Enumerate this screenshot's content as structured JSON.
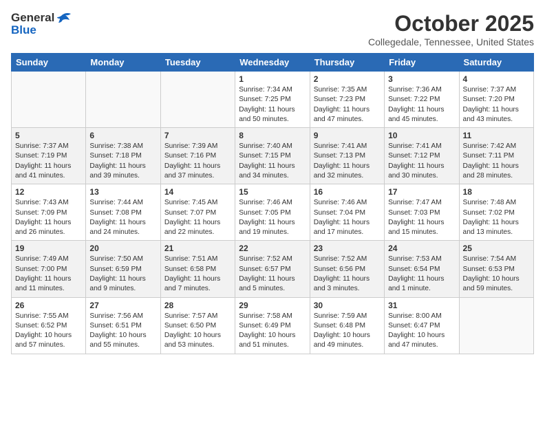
{
  "header": {
    "logo_general": "General",
    "logo_blue": "Blue",
    "month_title": "October 2025",
    "location": "Collegedale, Tennessee, United States"
  },
  "weekdays": [
    "Sunday",
    "Monday",
    "Tuesday",
    "Wednesday",
    "Thursday",
    "Friday",
    "Saturday"
  ],
  "weeks": [
    [
      {
        "num": "",
        "info": ""
      },
      {
        "num": "",
        "info": ""
      },
      {
        "num": "",
        "info": ""
      },
      {
        "num": "1",
        "info": "Sunrise: 7:34 AM\nSunset: 7:25 PM\nDaylight: 11 hours\nand 50 minutes."
      },
      {
        "num": "2",
        "info": "Sunrise: 7:35 AM\nSunset: 7:23 PM\nDaylight: 11 hours\nand 47 minutes."
      },
      {
        "num": "3",
        "info": "Sunrise: 7:36 AM\nSunset: 7:22 PM\nDaylight: 11 hours\nand 45 minutes."
      },
      {
        "num": "4",
        "info": "Sunrise: 7:37 AM\nSunset: 7:20 PM\nDaylight: 11 hours\nand 43 minutes."
      }
    ],
    [
      {
        "num": "5",
        "info": "Sunrise: 7:37 AM\nSunset: 7:19 PM\nDaylight: 11 hours\nand 41 minutes."
      },
      {
        "num": "6",
        "info": "Sunrise: 7:38 AM\nSunset: 7:18 PM\nDaylight: 11 hours\nand 39 minutes."
      },
      {
        "num": "7",
        "info": "Sunrise: 7:39 AM\nSunset: 7:16 PM\nDaylight: 11 hours\nand 37 minutes."
      },
      {
        "num": "8",
        "info": "Sunrise: 7:40 AM\nSunset: 7:15 PM\nDaylight: 11 hours\nand 34 minutes."
      },
      {
        "num": "9",
        "info": "Sunrise: 7:41 AM\nSunset: 7:13 PM\nDaylight: 11 hours\nand 32 minutes."
      },
      {
        "num": "10",
        "info": "Sunrise: 7:41 AM\nSunset: 7:12 PM\nDaylight: 11 hours\nand 30 minutes."
      },
      {
        "num": "11",
        "info": "Sunrise: 7:42 AM\nSunset: 7:11 PM\nDaylight: 11 hours\nand 28 minutes."
      }
    ],
    [
      {
        "num": "12",
        "info": "Sunrise: 7:43 AM\nSunset: 7:09 PM\nDaylight: 11 hours\nand 26 minutes."
      },
      {
        "num": "13",
        "info": "Sunrise: 7:44 AM\nSunset: 7:08 PM\nDaylight: 11 hours\nand 24 minutes."
      },
      {
        "num": "14",
        "info": "Sunrise: 7:45 AM\nSunset: 7:07 PM\nDaylight: 11 hours\nand 22 minutes."
      },
      {
        "num": "15",
        "info": "Sunrise: 7:46 AM\nSunset: 7:05 PM\nDaylight: 11 hours\nand 19 minutes."
      },
      {
        "num": "16",
        "info": "Sunrise: 7:46 AM\nSunset: 7:04 PM\nDaylight: 11 hours\nand 17 minutes."
      },
      {
        "num": "17",
        "info": "Sunrise: 7:47 AM\nSunset: 7:03 PM\nDaylight: 11 hours\nand 15 minutes."
      },
      {
        "num": "18",
        "info": "Sunrise: 7:48 AM\nSunset: 7:02 PM\nDaylight: 11 hours\nand 13 minutes."
      }
    ],
    [
      {
        "num": "19",
        "info": "Sunrise: 7:49 AM\nSunset: 7:00 PM\nDaylight: 11 hours\nand 11 minutes."
      },
      {
        "num": "20",
        "info": "Sunrise: 7:50 AM\nSunset: 6:59 PM\nDaylight: 11 hours\nand 9 minutes."
      },
      {
        "num": "21",
        "info": "Sunrise: 7:51 AM\nSunset: 6:58 PM\nDaylight: 11 hours\nand 7 minutes."
      },
      {
        "num": "22",
        "info": "Sunrise: 7:52 AM\nSunset: 6:57 PM\nDaylight: 11 hours\nand 5 minutes."
      },
      {
        "num": "23",
        "info": "Sunrise: 7:52 AM\nSunset: 6:56 PM\nDaylight: 11 hours\nand 3 minutes."
      },
      {
        "num": "24",
        "info": "Sunrise: 7:53 AM\nSunset: 6:54 PM\nDaylight: 11 hours\nand 1 minute."
      },
      {
        "num": "25",
        "info": "Sunrise: 7:54 AM\nSunset: 6:53 PM\nDaylight: 10 hours\nand 59 minutes."
      }
    ],
    [
      {
        "num": "26",
        "info": "Sunrise: 7:55 AM\nSunset: 6:52 PM\nDaylight: 10 hours\nand 57 minutes."
      },
      {
        "num": "27",
        "info": "Sunrise: 7:56 AM\nSunset: 6:51 PM\nDaylight: 10 hours\nand 55 minutes."
      },
      {
        "num": "28",
        "info": "Sunrise: 7:57 AM\nSunset: 6:50 PM\nDaylight: 10 hours\nand 53 minutes."
      },
      {
        "num": "29",
        "info": "Sunrise: 7:58 AM\nSunset: 6:49 PM\nDaylight: 10 hours\nand 51 minutes."
      },
      {
        "num": "30",
        "info": "Sunrise: 7:59 AM\nSunset: 6:48 PM\nDaylight: 10 hours\nand 49 minutes."
      },
      {
        "num": "31",
        "info": "Sunrise: 8:00 AM\nSunset: 6:47 PM\nDaylight: 10 hours\nand 47 minutes."
      },
      {
        "num": "",
        "info": ""
      }
    ]
  ]
}
